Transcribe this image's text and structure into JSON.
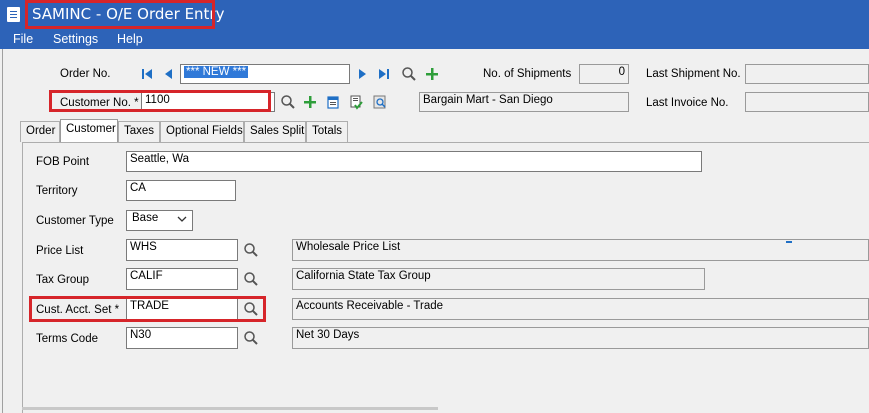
{
  "window": {
    "title": "SAMINC - O/E Order Entry"
  },
  "menu": [
    {
      "label": "File"
    },
    {
      "label": "Settings"
    },
    {
      "label": "Help"
    }
  ],
  "header": {
    "order_no_label": "Order No.",
    "order_no_value": "*** NEW ***",
    "shipments_label": "No. of Shipments",
    "shipments_value": "0",
    "last_shipment_label": "Last Shipment No.",
    "last_shipment_value": "",
    "customer_no_label": "Customer No. *",
    "customer_no_value": "1100",
    "customer_name": "Bargain Mart - San Diego",
    "last_invoice_label": "Last Invoice No.",
    "last_invoice_value": ""
  },
  "tabs": [
    {
      "label": "Order"
    },
    {
      "label": "Customer",
      "active": true
    },
    {
      "label": "Taxes"
    },
    {
      "label": "Optional Fields"
    },
    {
      "label": "Sales Split"
    },
    {
      "label": "Totals"
    }
  ],
  "customer_tab": {
    "fob_label": "FOB Point",
    "fob_value": "Seattle, Wa",
    "territory_label": "Territory",
    "territory_value": "CA",
    "customer_type_label": "Customer Type",
    "customer_type_value": "Base",
    "price_list_label": "Price List",
    "price_list_value": "WHS",
    "price_list_desc": "Wholesale Price List",
    "tax_group_label": "Tax Group",
    "tax_group_value": "CALIF",
    "tax_group_desc": "California State Tax Group",
    "acct_set_label": "Cust. Acct. Set *",
    "acct_set_value": "TRADE",
    "acct_set_desc": "Accounts Receivable - Trade",
    "terms_label": "Terms Code",
    "terms_value": "N30",
    "terms_desc": "Net 30 Days"
  },
  "colors": {
    "titlebar": "#2d63b8",
    "highlight": "#d6252a",
    "nav_blue": "#1f6fc5",
    "add_green": "#2e9e3a"
  }
}
